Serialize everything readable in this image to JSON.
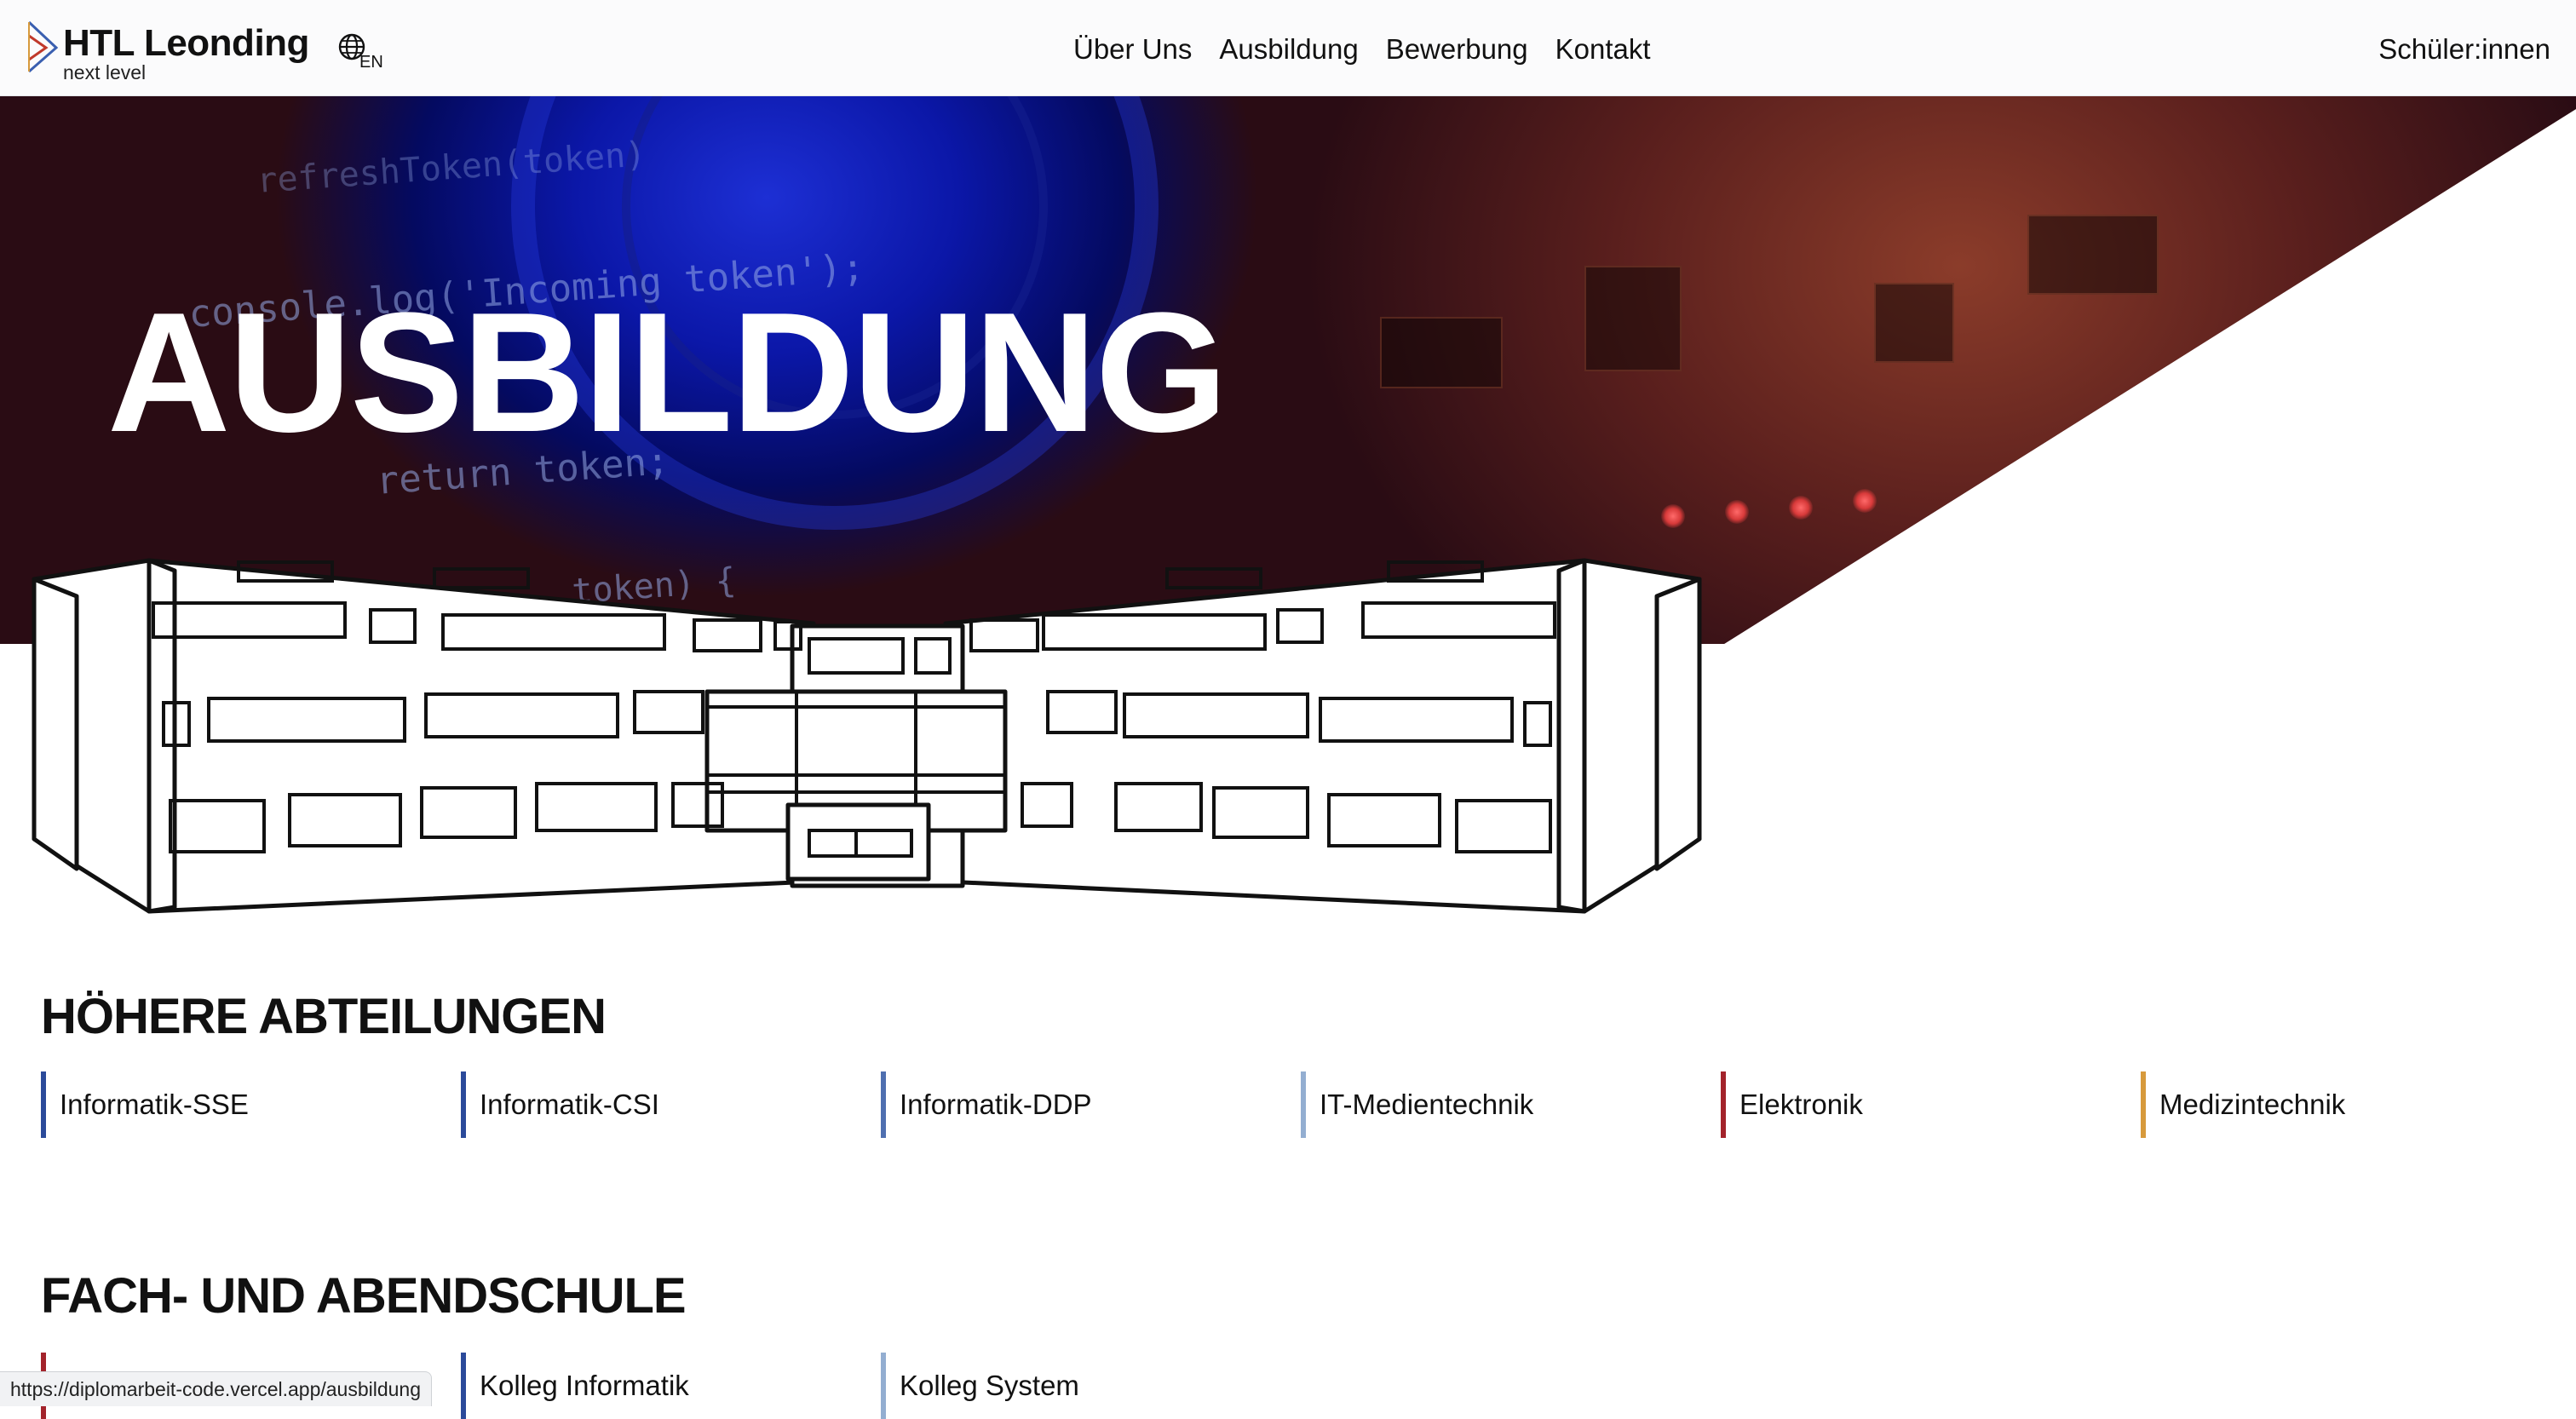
{
  "header": {
    "logo_title": "HTL Leonding",
    "logo_subtitle": "next level",
    "language_code": "EN",
    "nav": [
      "Über Uns",
      "Ausbildung",
      "Bewerbung",
      "Kontakt"
    ],
    "right_link": "Schüler:innen"
  },
  "hero": {
    "title": "AUSBILDUNG",
    "code_lines": [
      "console.log('Incoming token');",
      "return token;",
      "token) {",
      "refreshToken(token)"
    ]
  },
  "sections": [
    {
      "title": "HÖHERE ABTEILUNGEN",
      "items": [
        {
          "label": "Informatik-SSE",
          "color": "#2b4a9a"
        },
        {
          "label": "Informatik-CSI",
          "color": "#2b4a9a"
        },
        {
          "label": "Informatik-DDP",
          "color": "#4f6fb0"
        },
        {
          "label": "IT-Medientechnik",
          "color": "#93aed1"
        },
        {
          "label": "Elektronik",
          "color": "#a3232b"
        },
        {
          "label": "Medizintechnik",
          "color": "#d79a3c"
        }
      ]
    },
    {
      "title": "FACH- UND ABENDSCHULE",
      "items": [
        {
          "label": "",
          "color": "#a3232b"
        },
        {
          "label": "Kolleg Informatik",
          "color": "#2b4a9a"
        },
        {
          "label": "Kolleg System",
          "color": "#93aed1"
        }
      ]
    }
  ],
  "status_url": "https://diplomarbeit-code.vercel.app/ausbildung"
}
